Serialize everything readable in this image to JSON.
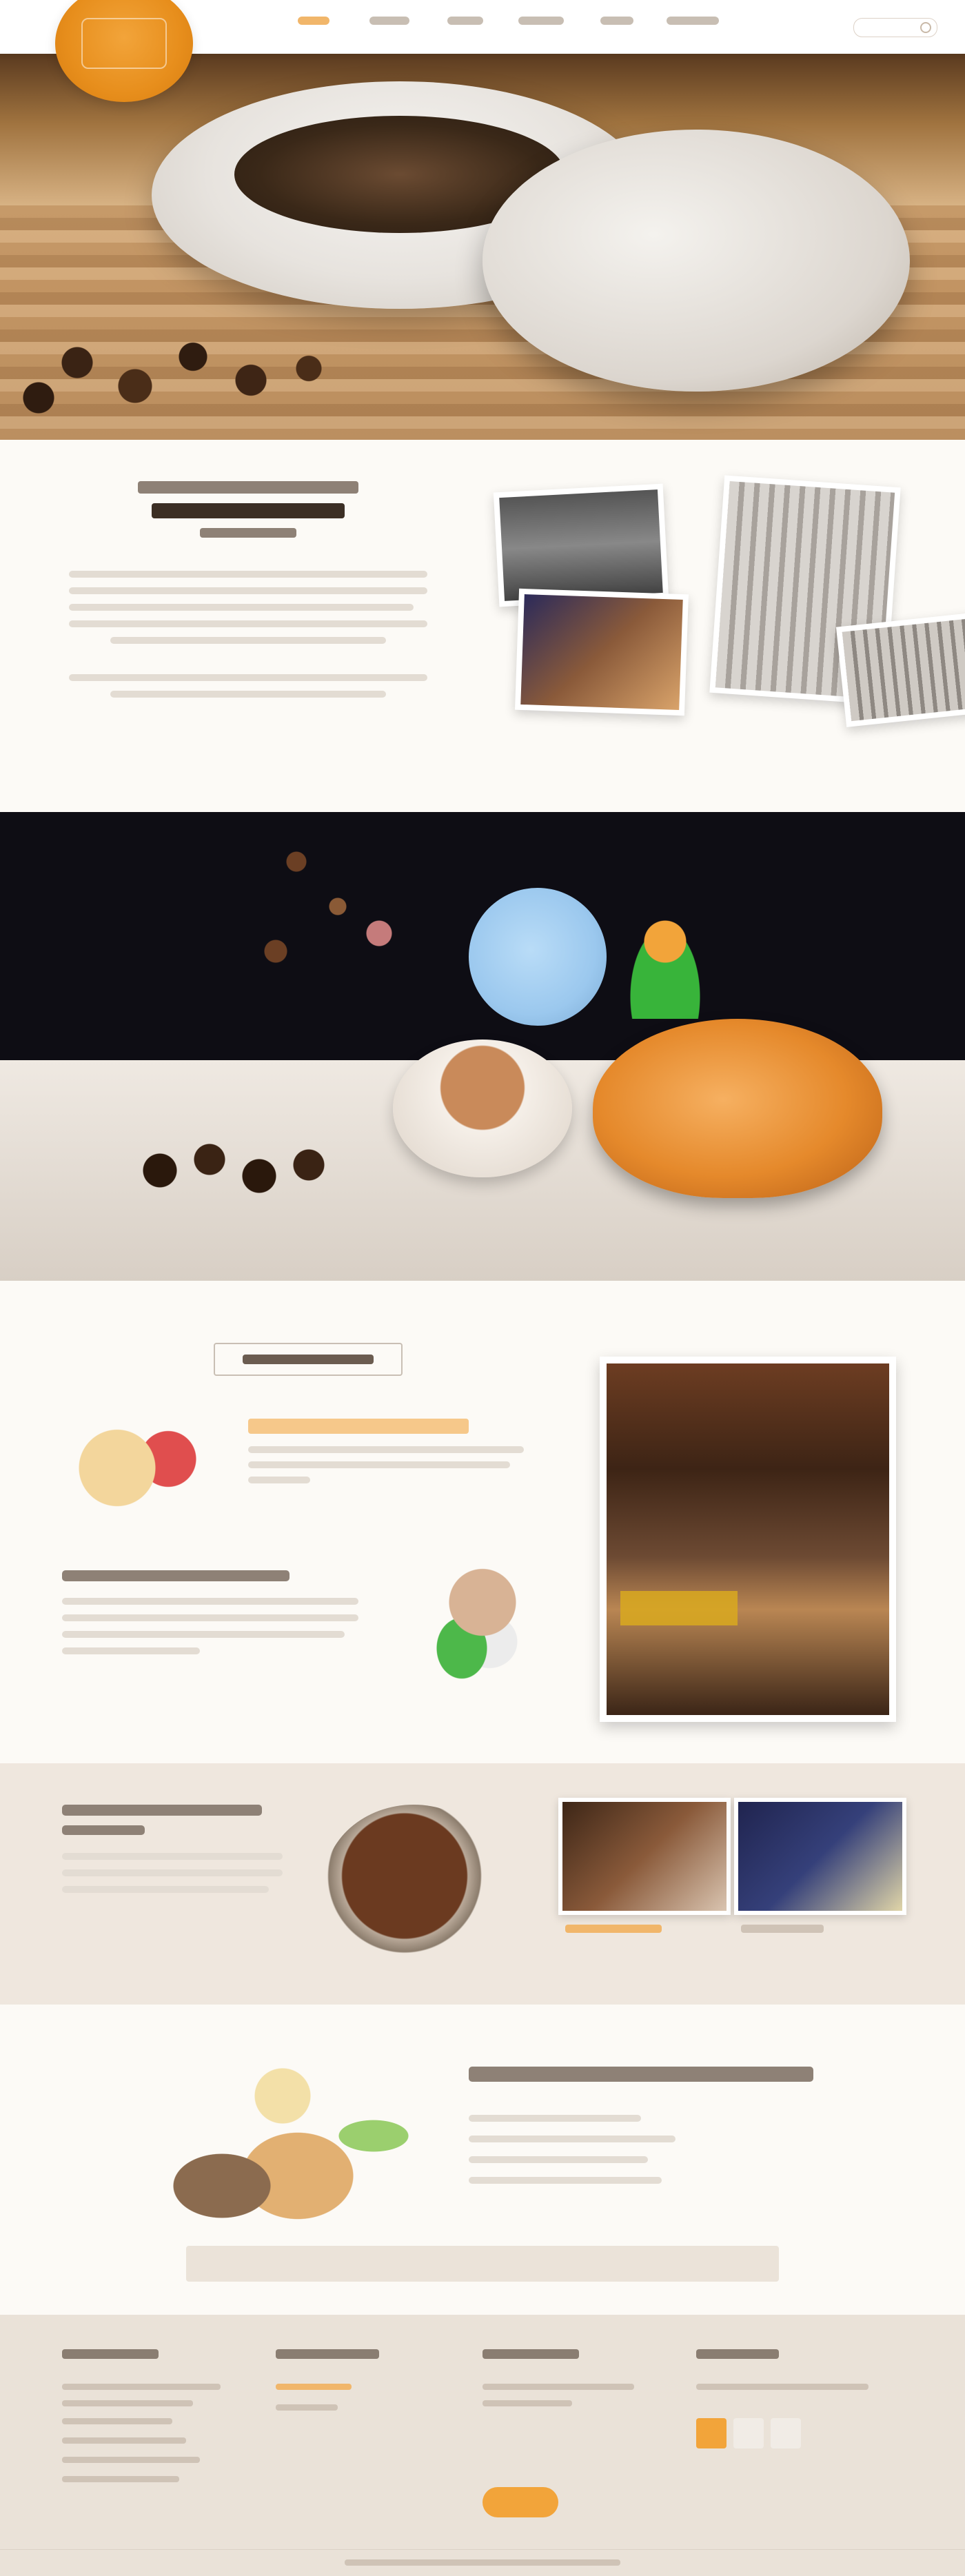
{
  "colors": {
    "accent": "#f2a43a",
    "background": "#fbf8f3",
    "footer_bg": "#eae2d8",
    "dark_banner": "#0e0d14"
  },
  "icons": [
    "search-icon"
  ]
}
